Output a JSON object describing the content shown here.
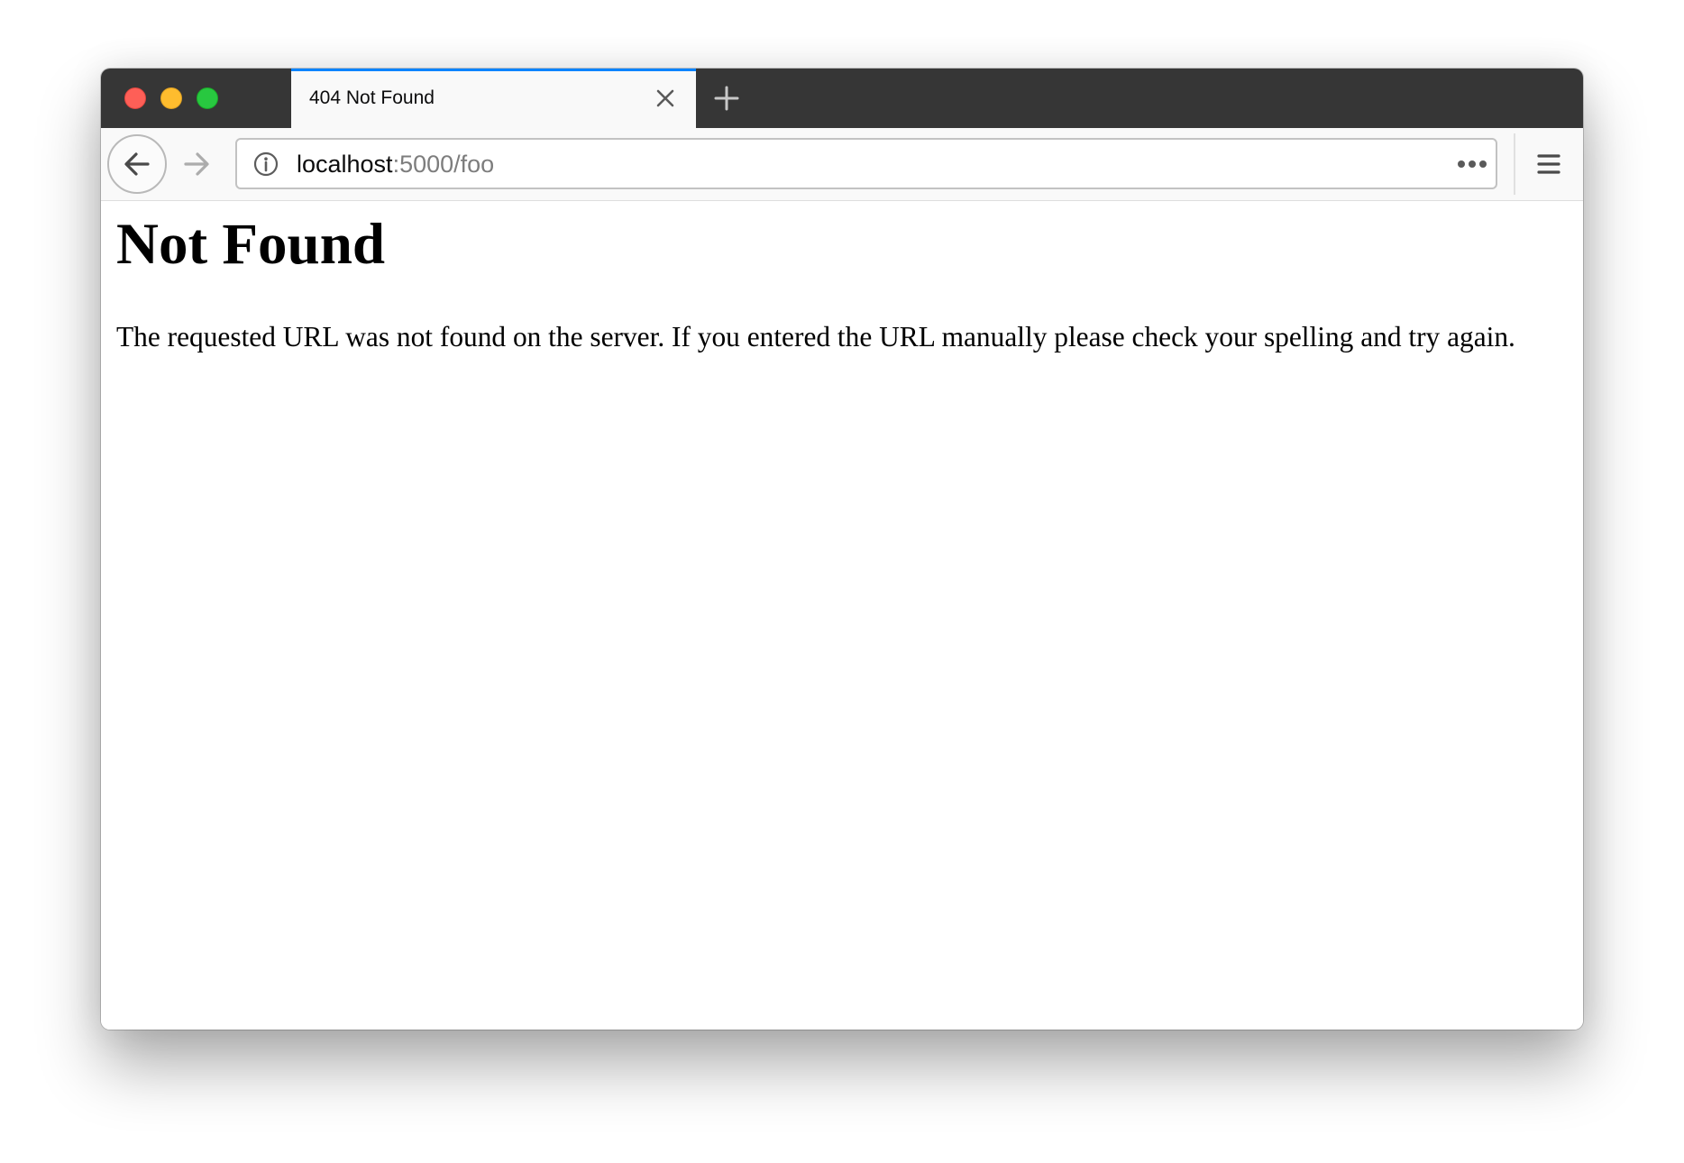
{
  "browser": {
    "window_controls": {
      "close_color": "#fe5f57",
      "minimize_color": "#febc2e",
      "zoom_color": "#28c840"
    },
    "tabs": [
      {
        "title": "404 Not Found",
        "active": true,
        "accent_color": "#0a84ff"
      }
    ],
    "toolbar": {
      "back_icon": "arrow-left-icon",
      "forward_icon": "arrow-right-icon",
      "url_host": "localhost",
      "url_rest": ":5000/foo",
      "site_info_icon": "info-icon",
      "page_actions_icon": "ellipsis-icon",
      "menu_icon": "hamburger-menu-icon"
    }
  },
  "page": {
    "heading": "Not Found",
    "message": "The requested URL was not found on the server. If you entered the URL manually please check your spelling and try again."
  }
}
